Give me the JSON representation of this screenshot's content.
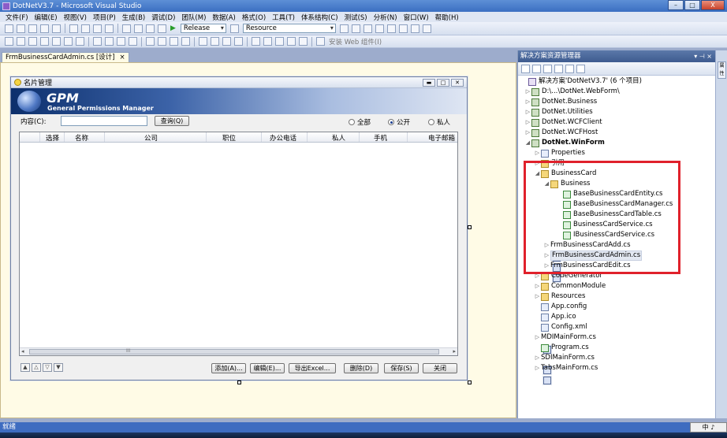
{
  "window": {
    "title": "DotNetV3.7 - Microsoft Visual Studio",
    "minimize_icon": "minimize-icon",
    "maximize_icon": "maximize-icon",
    "close_label": "X"
  },
  "menu": [
    "文件(F)",
    "编辑(E)",
    "视图(V)",
    "项目(P)",
    "生成(B)",
    "调试(D)",
    "团队(M)",
    "数据(A)",
    "格式(O)",
    "工具(T)",
    "体系结构(C)",
    "测试(S)",
    "分析(N)",
    "窗口(W)",
    "帮助(H)"
  ],
  "toolbar": {
    "configuration": "Release",
    "find_combo": "Resource",
    "install_web_label": "安装 Web 组件(I)"
  },
  "document_tab": {
    "label": "FrmBusinessCardAdmin.cs [设计]",
    "close": "×"
  },
  "form": {
    "title": "名片管理",
    "banner_logo": "GPM",
    "banner_subtitle": "General Permissions Manager",
    "search_label": "内容(C):",
    "search_value": "",
    "search_button": "查询(Q)",
    "radio_all": "全部",
    "radio_public": "公开",
    "radio_private": "私人",
    "radio_selected": "public",
    "columns": [
      "选择",
      "名称",
      "公司",
      "职位",
      "办公电话",
      "私人",
      "手机",
      "电子邮箱"
    ],
    "scroll_grip": "III",
    "nav": [
      "▲",
      "△",
      "▽",
      "▼"
    ],
    "buttons": {
      "add": "添加(A)...",
      "edit": "编辑(E)...",
      "export": "导出Excel...",
      "delete": "删除(D)",
      "save": "保存(S)",
      "close": "关闭"
    }
  },
  "solution_explorer": {
    "title": "解决方案资源管理器",
    "pin_label": "▾ ⊣ ×",
    "nodes": [
      {
        "label": "解决方案'DotNetV3.7' (6 个项目)",
        "bold": false
      },
      {
        "label": "D:\\...\\DotNet.WebForm\\",
        "bold": false
      },
      {
        "label": "DotNet.Business",
        "bold": false
      },
      {
        "label": "DotNet.Utilities",
        "bold": false
      },
      {
        "label": "DotNet.WCFClient",
        "bold": false
      },
      {
        "label": "DotNet.WCFHost",
        "bold": false
      },
      {
        "label": "DotNet.WinForm",
        "bold": true
      },
      {
        "label": "Properties",
        "bold": false
      },
      {
        "label": "引用",
        "bold": false
      },
      {
        "label": "BusinessCard",
        "bold": false
      },
      {
        "label": "Business",
        "bold": false
      },
      {
        "label": "BaseBusinessCardEntity.cs",
        "bold": false
      },
      {
        "label": "BaseBusinessCardManager.cs",
        "bold": false
      },
      {
        "label": "BaseBusinessCardTable.cs",
        "bold": false
      },
      {
        "label": "BusinessCardService.cs",
        "bold": false
      },
      {
        "label": "IBusinessCardService.cs",
        "bold": false
      },
      {
        "label": "FrmBusinessCardAdd.cs",
        "bold": false
      },
      {
        "label": "FrmBusinessCardAdmin.cs",
        "bold": false
      },
      {
        "label": "FrmBusinessCardEdit.cs",
        "bold": false
      },
      {
        "label": "CodeGenerator",
        "bold": false
      },
      {
        "label": "CommonModule",
        "bold": false
      },
      {
        "label": "Resources",
        "bold": false
      },
      {
        "label": "App.config",
        "bold": false
      },
      {
        "label": "App.ico",
        "bold": false
      },
      {
        "label": "Config.xml",
        "bold": false
      },
      {
        "label": "MDIMainForm.cs",
        "bold": false
      },
      {
        "label": "Program.cs",
        "bold": false
      },
      {
        "label": "SDIMainForm.cs",
        "bold": false
      },
      {
        "label": "TabsMainForm.cs",
        "bold": false
      }
    ]
  },
  "sidebar_tab": "属性",
  "status": "就绪",
  "ime": "中 ♪"
}
